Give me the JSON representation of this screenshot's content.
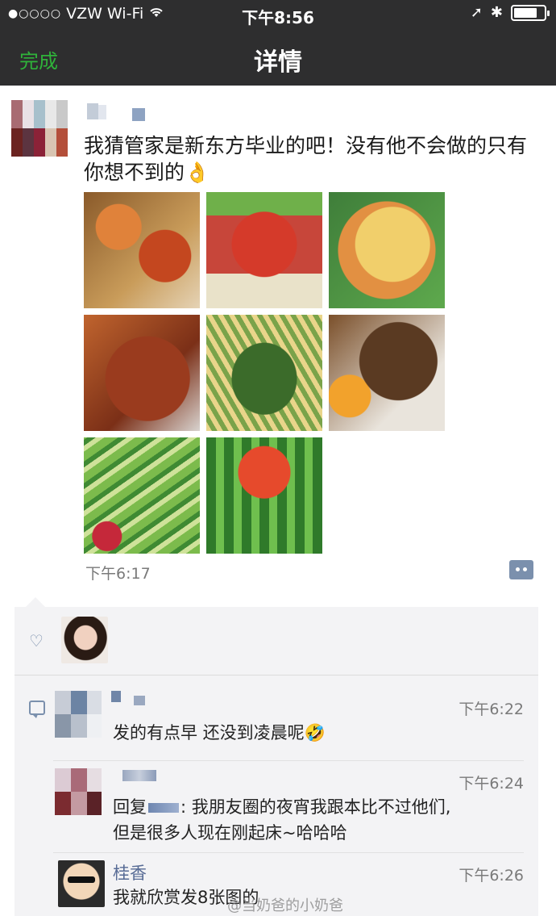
{
  "status_bar": {
    "carrier": "VZW Wi-Fi",
    "time": "下午8:56"
  },
  "nav": {
    "done_label": "完成",
    "title": "详情"
  },
  "post": {
    "text": "我猜管家是新东方毕业的吧！没有他不会做的只有你想不到的👌",
    "time": "下午6:17",
    "photos": [
      "photo-1",
      "photo-2",
      "photo-3",
      "photo-4",
      "photo-5",
      "photo-6",
      "photo-7",
      "photo-8"
    ]
  },
  "comments": [
    {
      "time": "下午6:22",
      "text": "发的有点早 还没到凌晨呢🤣"
    },
    {
      "time": "下午6:24",
      "reply_prefix": "回复",
      "text_line1": ": 我朋友圈的夜宵我跟本比不过他们,",
      "text_line2": "但是很多人现在刚起床~哈哈哈"
    },
    {
      "name": "桂香",
      "time": "下午6:26",
      "text": "我就欣赏发8张图的"
    }
  ],
  "watermark": "@当奶爸的小奶爸",
  "colors": {
    "topbar": "#2e2e2f",
    "done_green": "#2fb33a",
    "link_blue": "#576b95",
    "icon_blue": "#7b90ad"
  }
}
